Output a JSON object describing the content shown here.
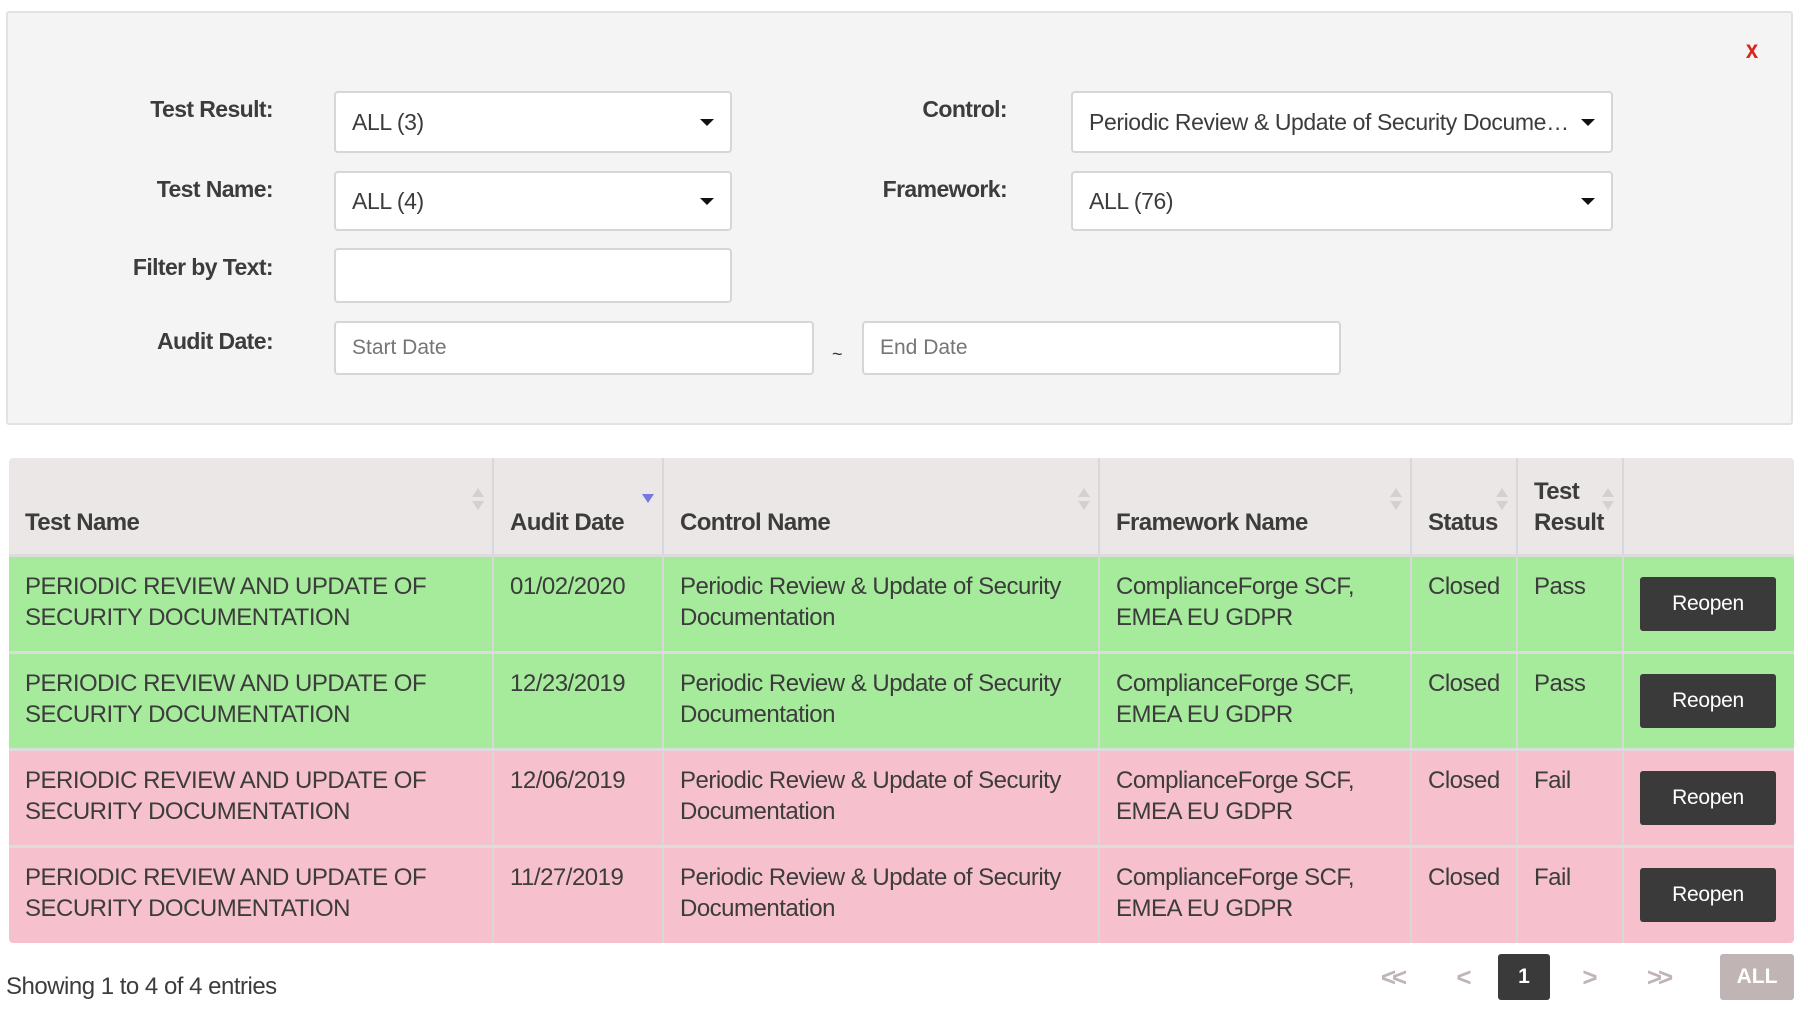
{
  "filters": {
    "close_label": "x",
    "test_result": {
      "label": "Test Result:",
      "value": "ALL (3)"
    },
    "test_name": {
      "label": "Test Name:",
      "value": "ALL (4)"
    },
    "filter_text": {
      "label": "Filter by Text:",
      "value": ""
    },
    "audit_date": {
      "label": "Audit Date:",
      "start_placeholder": "Start Date",
      "end_placeholder": "End Date",
      "separator": "~"
    },
    "control": {
      "label": "Control:",
      "value": "Periodic Review & Update of Security Documentation"
    },
    "framework": {
      "label": "Framework:",
      "value": "ALL (76)"
    }
  },
  "table": {
    "columns": [
      {
        "label": "Test Name",
        "sort": "none"
      },
      {
        "label": "Audit Date",
        "sort": "desc"
      },
      {
        "label": "Control Name",
        "sort": "none"
      },
      {
        "label": "Framework Name",
        "sort": "none"
      },
      {
        "label": "Status",
        "sort": "none"
      },
      {
        "label": "Test Result",
        "sort": "none"
      },
      {
        "label": "",
        "sort": ""
      }
    ],
    "rows": [
      {
        "test_name": "PERIODIC REVIEW AND UPDATE OF SECURITY DOCUMENTATION",
        "audit_date": "01/02/2020",
        "control_name": "Periodic Review & Update of Security Documentation",
        "framework_name": "ComplianceForge SCF, EMEA EU GDPR",
        "status": "Closed",
        "test_result": "Pass",
        "action": "Reopen",
        "row_color": "#a6ea9c"
      },
      {
        "test_name": "PERIODIC REVIEW AND UPDATE OF SECURITY DOCUMENTATION",
        "audit_date": "12/23/2019",
        "control_name": "Periodic Review & Update of Security Documentation",
        "framework_name": "ComplianceForge SCF, EMEA EU GDPR",
        "status": "Closed",
        "test_result": "Pass",
        "action": "Reopen",
        "row_color": "#a6ea9c"
      },
      {
        "test_name": "PERIODIC REVIEW AND UPDATE OF SECURITY DOCUMENTATION",
        "audit_date": "12/06/2019",
        "control_name": "Periodic Review & Update of Security Documentation",
        "framework_name": "ComplianceForge SCF, EMEA EU GDPR",
        "status": "Closed",
        "test_result": "Fail",
        "action": "Reopen",
        "row_color": "#f6c1cc"
      },
      {
        "test_name": "PERIODIC REVIEW AND UPDATE OF SECURITY DOCUMENTATION",
        "audit_date": "11/27/2019",
        "control_name": "Periodic Review & Update of Security Documentation",
        "framework_name": "ComplianceForge SCF, EMEA EU GDPR",
        "status": "Closed",
        "test_result": "Fail",
        "action": "Reopen",
        "row_color": "#f6c1cc"
      }
    ]
  },
  "footer": {
    "info": "Showing 1 to 4 of 4 entries",
    "pagination": {
      "first": "<<",
      "prev": "<",
      "current": "1",
      "next": ">",
      "last": ">>",
      "all": "ALL"
    }
  },
  "colors": {
    "pass_row": "#a6ea9c",
    "fail_row": "#f6c1cc",
    "close_icon": "#d9261c",
    "button_dark": "#3a3a3a",
    "sort_active": "#7478e0"
  }
}
